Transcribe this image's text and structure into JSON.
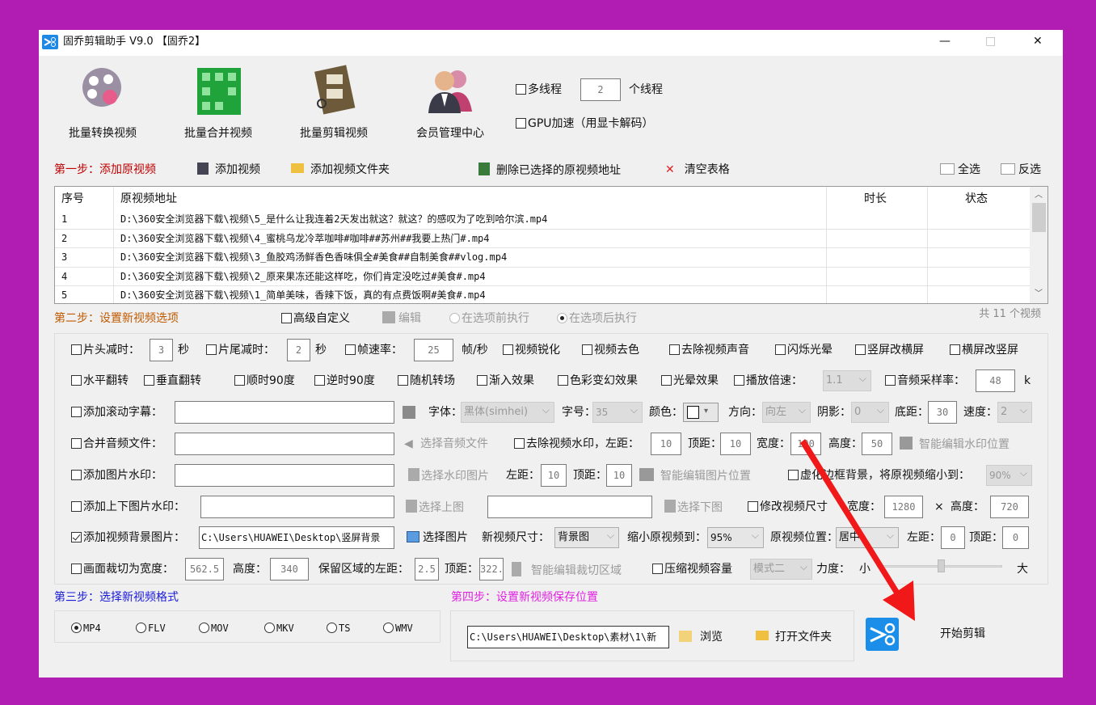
{
  "window": {
    "title": "固乔剪辑助手 V9.0 【固乔2】",
    "minimize": "—",
    "maximize": "□",
    "close": "✕"
  },
  "toolbar": {
    "items": [
      {
        "label": "批量转换视频",
        "icon": "film-reel-icon"
      },
      {
        "label": "批量合并视频",
        "icon": "merge-grid-icon"
      },
      {
        "label": "批量剪辑视频",
        "icon": "film-scissors-icon"
      },
      {
        "label": "会员管理中心",
        "icon": "users-icon"
      }
    ]
  },
  "multithread": {
    "label": "多线程",
    "value": "2",
    "unit": "个线程",
    "checked": false
  },
  "gpu": {
    "label": "GPU加速（用显卡解码）",
    "checked": false
  },
  "step1": {
    "title": "第一步：添加原视频",
    "add_video": "添加视频",
    "add_folder": "添加视频文件夹",
    "delete_selected": "删除已选择的原视频地址",
    "clear_table": "清空表格",
    "select_all": "全选",
    "invert": "反选"
  },
  "table": {
    "headers": [
      "序号",
      "原视频地址",
      "时长",
      "状态"
    ],
    "rows": [
      {
        "no": "1",
        "path": "D:\\360安全浏览器下载\\视频\\5_是什么让我连着2天发出就这？就这？的感叹为了吃到哈尔滨.mp4"
      },
      {
        "no": "2",
        "path": "D:\\360安全浏览器下载\\视频\\4_蜜桃乌龙冷萃咖啡#咖啡##苏州##我要上热门#.mp4"
      },
      {
        "no": "3",
        "path": "D:\\360安全浏览器下载\\视频\\3_鱼胶鸡汤鲜香色香味俱全#美食##自制美食##vlog.mp4"
      },
      {
        "no": "4",
        "path": "D:\\360安全浏览器下载\\视频\\2_原来果冻还能这样吃，你们肯定没吃过#美食#.mp4"
      },
      {
        "no": "5",
        "path": "D:\\360安全浏览器下载\\视频\\1_简单美味，香辣下饭，真的有点费饭啊#美食#.mp4"
      }
    ],
    "count": "共 11 个视频"
  },
  "step2": {
    "title": "第二步：设置新视频选项",
    "advanced": "高级自定义",
    "edit": "编辑",
    "before": "在选项前执行",
    "after": "在选项后执行"
  },
  "opts": {
    "head_cut": "片头减时：",
    "head_val": "3",
    "sec": "秒",
    "tail_cut": "片尾减时：",
    "tail_val": "2",
    "fps": "帧速率：",
    "fps_val": "25",
    "fps_unit": "帧/秒",
    "sharpen": "视频锐化",
    "decolor": "视频去色",
    "mute": "去除视频声音",
    "flash": "闪烁光晕",
    "v2h": "竖屏改横屏",
    "h2v": "横屏改竖屏",
    "hflip": "水平翻转",
    "vflip": "垂直翻转",
    "cw90": "顺时90度",
    "ccw90": "逆时90度",
    "transition": "随机转场",
    "fadein": "渐入效果",
    "color_fx": "色彩变幻效果",
    "halo": "光晕效果",
    "speed": "播放倍速：",
    "speed_val": "1.1",
    "samplerate": "音频采样率：",
    "samplerate_val": "48",
    "samplerate_unit": "k",
    "marquee": "添加滚动字幕：",
    "font": "字体：",
    "font_val": "黑体(simhei)",
    "fontsize": "字号：",
    "fontsize_val": "35",
    "color": "颜色：",
    "direction": "方向：",
    "direction_val": "向左",
    "shadow": "阴影：",
    "shadow_val": "0",
    "bottom": "底距：",
    "bottom_val": "30",
    "mspeed": "速度：",
    "mspeed_val": "2",
    "audio": "合并音频文件：",
    "choose_audio": "选择音频文件",
    "remove_wm": "去除视频水印，左距：",
    "wm_left": "10",
    "top": "顶距：",
    "wm_top": "10",
    "width": "宽度：",
    "wm_width": "100",
    "height": "高度：",
    "wm_height": "50",
    "smart_wm": "智能编辑水印位置",
    "img_wm": "添加图片水印：",
    "choose_wm_img": "选择水印图片",
    "left": "左距：",
    "img_left": "10",
    "img_top": "10",
    "smart_img": "智能编辑图片位置",
    "blur_bg": "虚化边框背景，将原视频缩小到：",
    "blur_val": "90%",
    "tb_wm": "添加上下图片水印：",
    "choose_top": "选择上图",
    "choose_bottom": "选择下图",
    "resize": "修改视频尺寸",
    "resize_w": "1280",
    "times": "×",
    "resize_h": "720",
    "bg_img": "添加视频背景图片：",
    "bg_path": "C:\\Users\\HUAWEI\\Desktop\\竖屏背景",
    "choose_img": "选择图片",
    "new_size": "新视频尺寸：",
    "new_size_val": "背景图",
    "shrink": "缩小原视频到：",
    "shrink_val": "95%",
    "position": "原视频位置：",
    "position_val": "居中",
    "pos_left": "0",
    "pos_top": "0",
    "crop": "画面裁切为宽度：",
    "crop_w": "562.5",
    "crop_h": "340",
    "keep_left": "保留区域的左距：",
    "crop_left": "2.5",
    "crop_top": "322.",
    "smart_crop": "智能编辑裁切区域",
    "compress": "压缩视频容量",
    "compress_mode": "模式二",
    "strength": "力度：",
    "small": "小",
    "big": "大"
  },
  "opts_checked": {
    "bg_img": true
  },
  "step3": {
    "title": "第三步：选择新视频格式",
    "formats": [
      "MP4",
      "FLV",
      "MOV",
      "MKV",
      "TS",
      "WMV"
    ],
    "selected": "MP4"
  },
  "step4": {
    "title": "第四步：设置新视频保存位置",
    "path": "C:\\Users\\HUAWEI\\Desktop\\素材\\1\\新",
    "browse": "浏览",
    "open_folder": "打开文件夹",
    "start": "开始剪辑"
  },
  "colors": {
    "background": "#b11cb3",
    "step1": "#c00000",
    "step2": "#c05a00",
    "step3": "#1a1adb",
    "step4": "#e022e0",
    "arrow": "#f01818"
  }
}
